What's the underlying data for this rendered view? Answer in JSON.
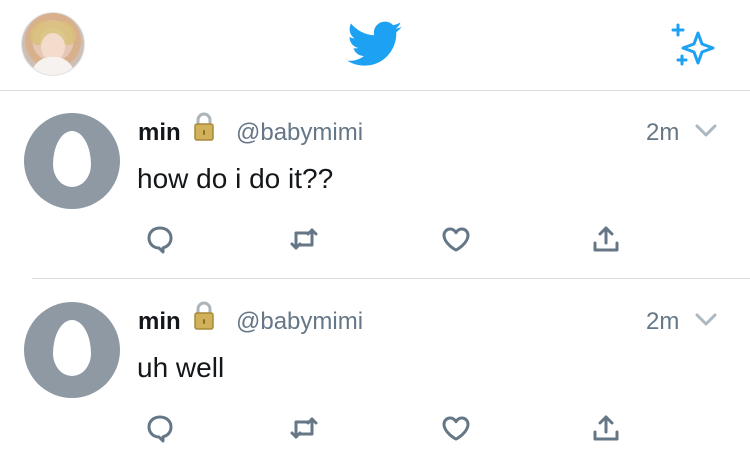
{
  "header": {
    "profile_icon": "profile-avatar",
    "brand_icon": "twitter-bird-icon",
    "sparkle_icon": "sparkle-icon",
    "brand_color": "#1da1f2"
  },
  "tweets": [
    {
      "name": "min",
      "handle": "@babymimi",
      "time": "2m",
      "text": "how do i do it??",
      "locked": true
    },
    {
      "name": "min",
      "handle": "@babymimi",
      "time": "2m",
      "text": "uh well",
      "locked": true
    }
  ],
  "actions": {
    "reply_icon": "reply-icon",
    "retweet_icon": "retweet-icon",
    "like_icon": "heart-icon",
    "share_icon": "share-icon",
    "icon_color": "#657786"
  }
}
